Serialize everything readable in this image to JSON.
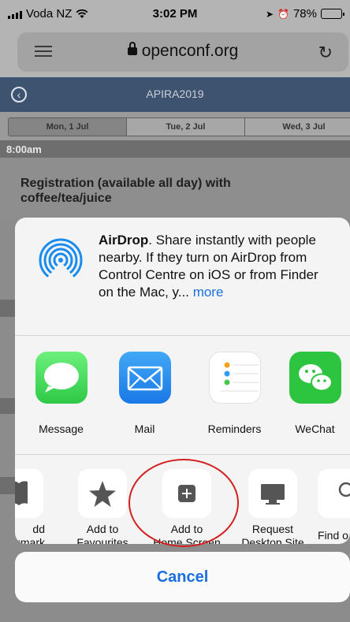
{
  "status_bar": {
    "carrier": "Voda NZ",
    "time": "3:02 PM",
    "battery": "78%",
    "battery_level": 0.78
  },
  "browser": {
    "url": "openconf.org",
    "icons": [
      "menu-icon",
      "lock-icon",
      "reload-icon"
    ]
  },
  "page": {
    "title": "APIRA2019",
    "days": [
      "Mon, 1 Jul",
      "Tue, 2 Jul",
      "Wed, 3 Jul"
    ],
    "time_slot": "8:00am",
    "session_title": "Registration (available all day) with coffee/tea/juice"
  },
  "share_sheet": {
    "airdrop": {
      "bold": "AirDrop",
      "text": ". Share instantly with people nearby. If they turn on AirDrop from Control Centre on iOS or from Finder on the Mac, y... ",
      "more": "more"
    },
    "apps": [
      {
        "label": "Message",
        "icon": "message-icon"
      },
      {
        "label": "Mail",
        "icon": "mail-icon"
      },
      {
        "label": "Reminders",
        "icon": "reminders-icon"
      },
      {
        "label": "WeChat",
        "icon": "wechat-icon"
      }
    ],
    "actions": [
      {
        "label_line1": "dd",
        "label_line2": "kmark",
        "icon": "bookmark-icon"
      },
      {
        "label_line1": "Add to",
        "label_line2": "Favourites",
        "icon": "star-icon"
      },
      {
        "label_line1": "Add to",
        "label_line2": "Home Screen",
        "icon": "plus-square-icon"
      },
      {
        "label_line1": "Request",
        "label_line2": "Desktop Site",
        "icon": "desktop-icon"
      },
      {
        "label_line1": "Find o",
        "label_line2": "",
        "icon": "search-icon"
      }
    ],
    "cancel": "Cancel"
  },
  "colors": {
    "link_blue": "#1a6fe0",
    "highlight_red": "#d41f1f",
    "header_navy": "#3d5370"
  }
}
